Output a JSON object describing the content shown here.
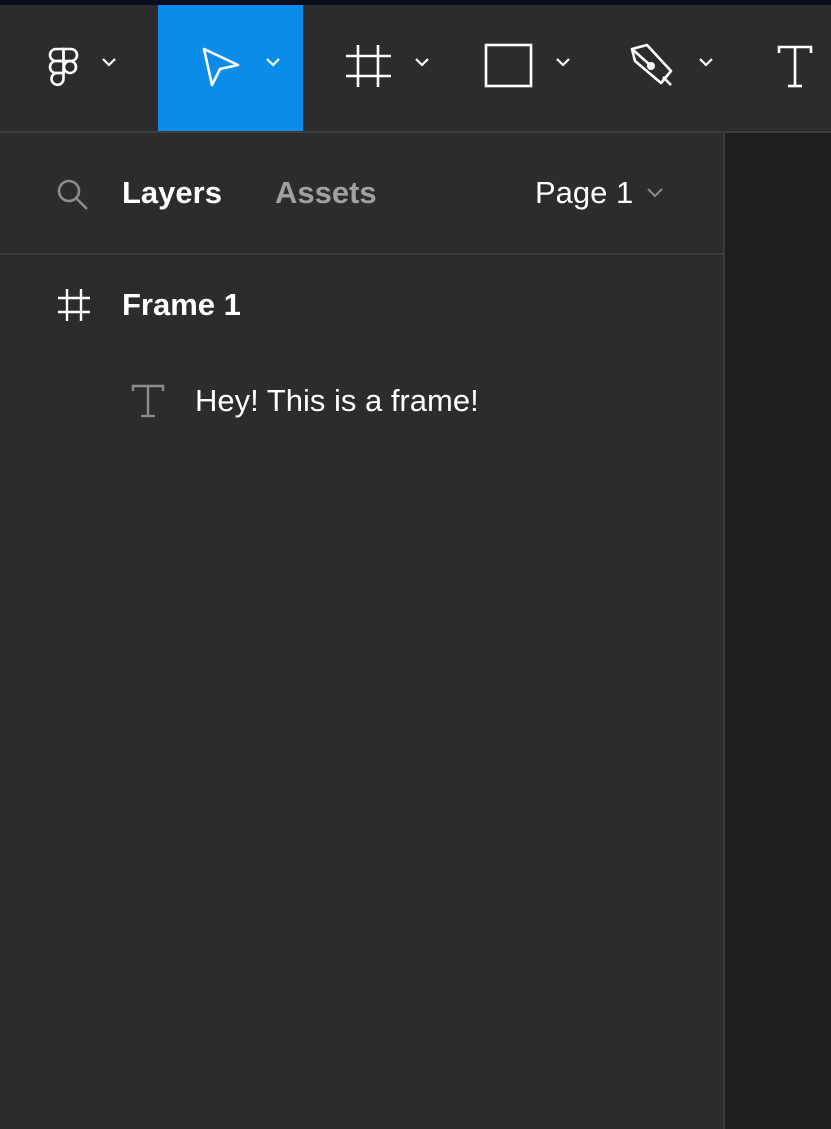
{
  "toolbar": {
    "tools": [
      {
        "name": "main-menu",
        "icon": "figma-logo-icon"
      },
      {
        "name": "move",
        "icon": "cursor-arrow-icon",
        "active": true
      },
      {
        "name": "frame",
        "icon": "frame-hash-icon"
      },
      {
        "name": "shape",
        "icon": "rectangle-icon"
      },
      {
        "name": "pen",
        "icon": "pen-icon"
      },
      {
        "name": "text",
        "icon": "text-icon"
      }
    ],
    "active_color": "#0c8ce9"
  },
  "panel": {
    "tabs": {
      "layers": "Layers",
      "assets": "Assets"
    },
    "page_select": "Page 1",
    "layers": [
      {
        "label": "Frame 1",
        "icon": "frame-hash-icon"
      },
      {
        "label": "Hey! This is a frame!",
        "icon": "text-icon"
      }
    ]
  }
}
